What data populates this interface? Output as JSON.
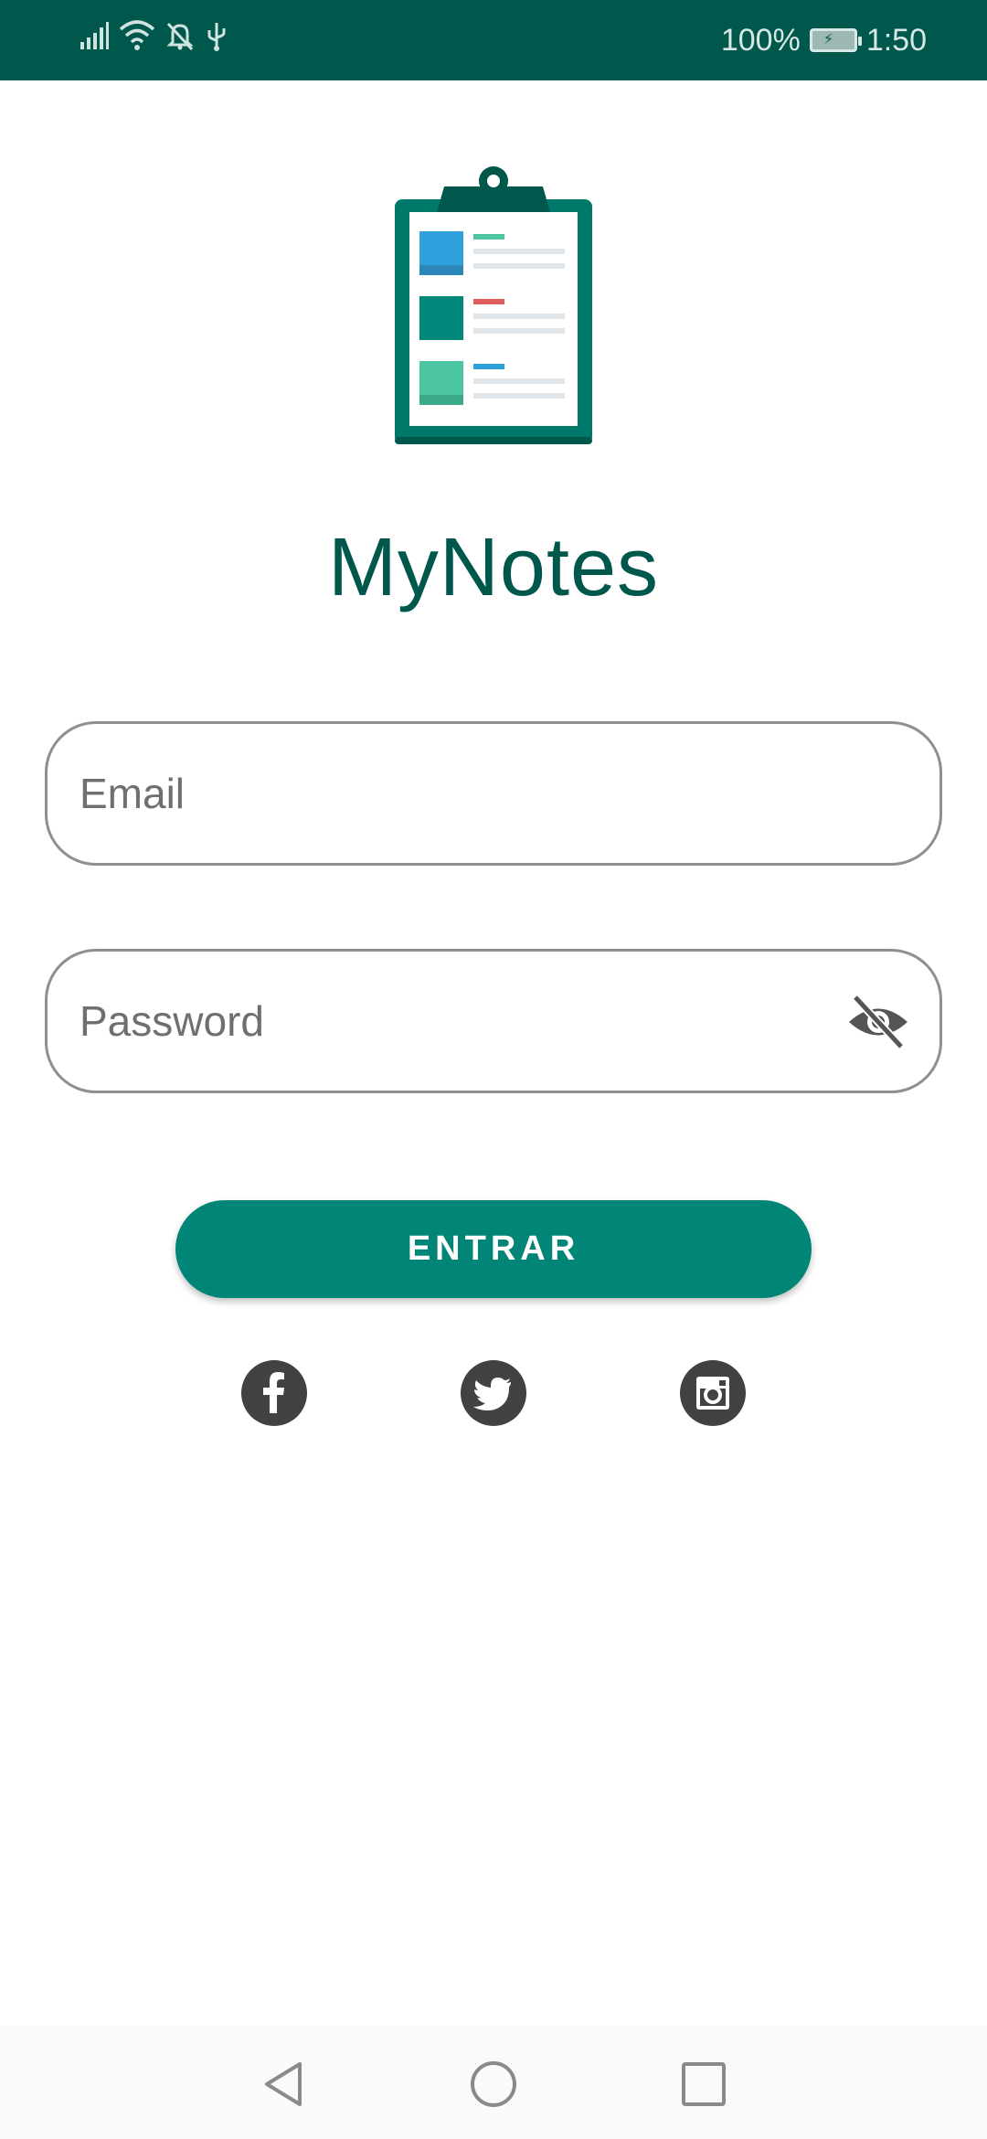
{
  "status_bar": {
    "battery_percent": "100%",
    "time": "1:50",
    "icons": [
      "signal-icon",
      "wifi-icon",
      "bell-off-icon",
      "usb-icon",
      "battery-charging-icon"
    ]
  },
  "app": {
    "title": "MyNotes",
    "logo_icon": "clipboard-notes-icon"
  },
  "form": {
    "email_placeholder": "Email",
    "password_placeholder": "Password",
    "password_toggle_icon": "eye-off-icon",
    "submit_label": "ENTRAR"
  },
  "social": [
    "facebook-icon",
    "twitter-icon",
    "instagram-icon"
  ],
  "nav": [
    "back-icon",
    "home-icon",
    "recents-icon"
  ],
  "colors": {
    "primary_dark": "#00574b",
    "primary": "#008577",
    "social_icon": "#424242"
  }
}
